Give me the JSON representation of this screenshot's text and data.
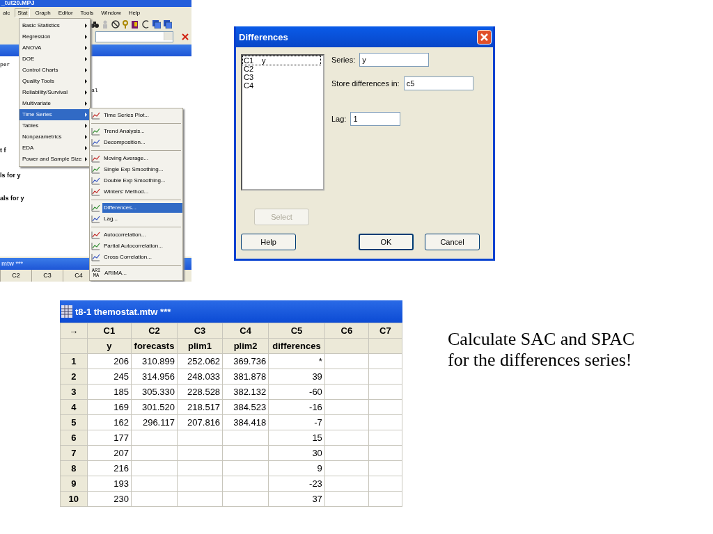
{
  "app_window": {
    "title": "_tut20.MPJ",
    "menu": [
      {
        "label": "alc",
        "selected": false
      },
      {
        "label": "Stat",
        "selected": true
      },
      {
        "label": "Graph",
        "selected": false
      },
      {
        "label": "Editor",
        "selected": false
      },
      {
        "label": "Tools",
        "selected": false
      },
      {
        "label": "Window",
        "selected": false
      },
      {
        "label": "Help",
        "selected": false
      }
    ],
    "session_text": [
      {
        "text": "per",
        "kind": "mono"
      },
      {
        "text": "al",
        "kind": "mono"
      },
      {
        "text": "t f",
        "kind": "bold"
      },
      {
        "text": "ls for y",
        "kind": "bold"
      },
      {
        "text": "als for y",
        "kind": "bold"
      }
    ],
    "stat_menu": [
      {
        "label": "Basic Statistics",
        "has_submenu": true,
        "selected": false
      },
      {
        "label": "Regression",
        "has_submenu": true,
        "selected": false
      },
      {
        "label": "ANOVA",
        "has_submenu": true,
        "selected": false
      },
      {
        "label": "DOE",
        "has_submenu": true,
        "selected": false
      },
      {
        "label": "Control Charts",
        "has_submenu": true,
        "selected": false
      },
      {
        "label": "Quality Tools",
        "has_submenu": true,
        "selected": false
      },
      {
        "label": "Reliability/Survival",
        "has_submenu": true,
        "selected": false
      },
      {
        "label": "Multivariate",
        "has_submenu": true,
        "selected": false
      },
      {
        "label": "Time Series",
        "has_submenu": true,
        "selected": true
      },
      {
        "label": "Tables",
        "has_submenu": true,
        "selected": false
      },
      {
        "label": "Nonparametrics",
        "has_submenu": true,
        "selected": false
      },
      {
        "label": "EDA",
        "has_submenu": true,
        "selected": false
      },
      {
        "label": "Power and Sample Size",
        "has_submenu": true,
        "selected": false
      }
    ],
    "time_series_menu": [
      {
        "label": "Time Series Plot...",
        "separator_before": false,
        "selected": false
      },
      {
        "label": "Trend Analysis...",
        "separator_before": true,
        "selected": false
      },
      {
        "label": "Decomposition...",
        "separator_before": false,
        "selected": false
      },
      {
        "label": "Moving Average...",
        "separator_before": true,
        "selected": false
      },
      {
        "label": "Single Exp Smoothing...",
        "separator_before": false,
        "selected": false
      },
      {
        "label": "Double Exp Smoothing...",
        "separator_before": false,
        "selected": false
      },
      {
        "label": "Winters' Method...",
        "separator_before": false,
        "selected": false
      },
      {
        "label": "Differences...",
        "separator_before": true,
        "selected": true
      },
      {
        "label": "Lag...",
        "separator_before": false,
        "selected": false
      },
      {
        "label": "Autocorrelation...",
        "separator_before": true,
        "selected": false
      },
      {
        "label": "Partial Autocorrelation...",
        "separator_before": false,
        "selected": false
      },
      {
        "label": "Cross Correlation...",
        "separator_before": false,
        "selected": false
      },
      {
        "label": "ARIMA...",
        "separator_before": true,
        "selected": false,
        "icon_text": [
          "ARI",
          "MA"
        ]
      }
    ],
    "worksheet_strip": {
      "title": "mtw ***",
      "columns": [
        "C2",
        "C3",
        "C4"
      ]
    }
  },
  "dialog": {
    "title": "Differences",
    "columns": [
      {
        "column": "C1",
        "name": "y",
        "focused": true
      },
      {
        "column": "C2",
        "focused": false
      },
      {
        "column": "C3",
        "focused": false
      },
      {
        "column": "C4",
        "focused": false
      }
    ],
    "fields": [
      {
        "label": "Series:",
        "value": "y"
      },
      {
        "label": "Store differences in:",
        "value": "c5"
      },
      {
        "label": "Lag:",
        "value": "1"
      }
    ],
    "select_button": {
      "label": "Select",
      "disabled": true
    },
    "buttons": [
      {
        "label": "Help",
        "default": false
      },
      {
        "label": "OK",
        "default": true
      },
      {
        "label": "Cancel",
        "default": false
      }
    ]
  },
  "worksheet": {
    "title": "t8-1 themostat.mtw ***",
    "corner": "→",
    "columns": [
      {
        "id": "C1",
        "name": "y"
      },
      {
        "id": "C2",
        "name": "forecasts"
      },
      {
        "id": "C3",
        "name": "plim1"
      },
      {
        "id": "C4",
        "name": "plim2"
      },
      {
        "id": "C5",
        "name": "differences"
      },
      {
        "id": "C6"
      },
      {
        "id": "C7"
      }
    ],
    "rows": [
      {
        "number": "1",
        "cells": [
          "206",
          "310.899",
          "252.062",
          "369.736",
          "*"
        ]
      },
      {
        "number": "2",
        "cells": [
          "245",
          "314.956",
          "248.033",
          "381.878",
          "39"
        ]
      },
      {
        "number": "3",
        "cells": [
          "185",
          "305.330",
          "228.528",
          "382.132",
          "-60"
        ]
      },
      {
        "number": "4",
        "cells": [
          "169",
          "301.520",
          "218.517",
          "384.523",
          "-16"
        ]
      },
      {
        "number": "5",
        "cells": [
          "162",
          "296.117",
          "207.816",
          "384.418",
          "-7"
        ]
      },
      {
        "number": "6",
        "cells": [
          "177",
          null,
          null,
          null,
          "15"
        ]
      },
      {
        "number": "7",
        "cells": [
          "207",
          null,
          null,
          null,
          "30"
        ]
      },
      {
        "number": "8",
        "cells": [
          "216",
          null,
          null,
          null,
          "9"
        ]
      },
      {
        "number": "9",
        "cells": [
          "193",
          null,
          null,
          null,
          "-23"
        ]
      },
      {
        "number": "10",
        "cells": [
          "230",
          null,
          null,
          null,
          "37"
        ]
      }
    ]
  },
  "note": "Calculate SAC and SPAC for the differences series!"
}
